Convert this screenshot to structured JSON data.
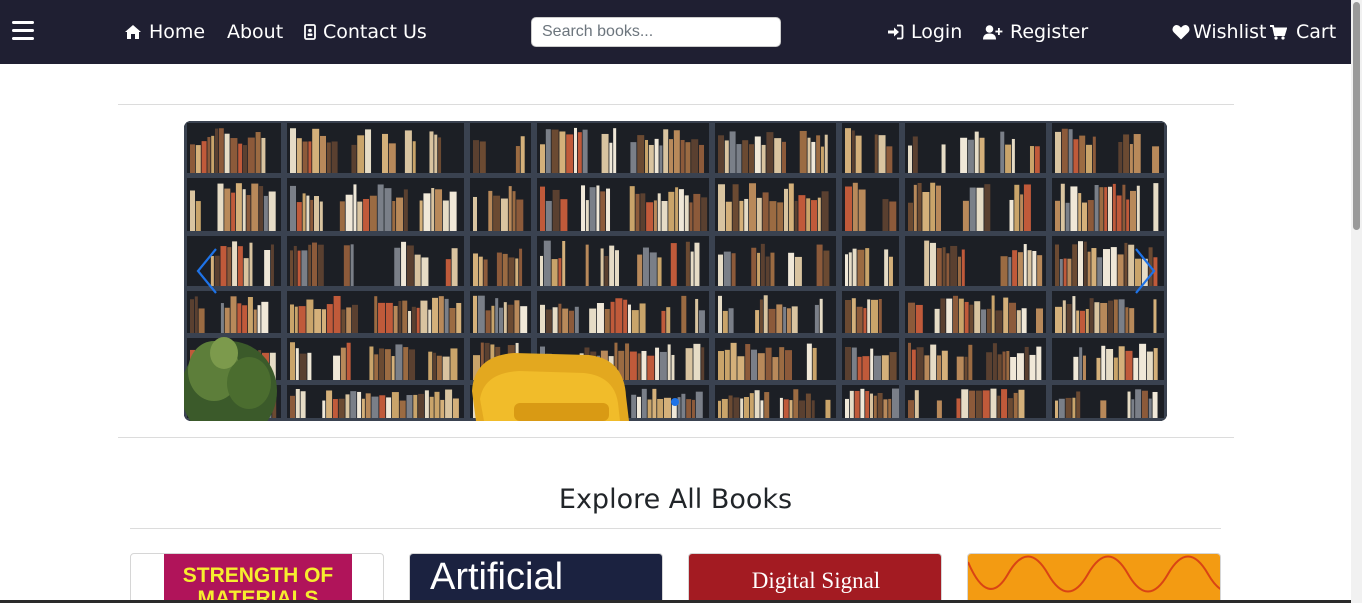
{
  "nav": {
    "home": "Home",
    "about": "About",
    "contact": "Contact Us",
    "login": "Login",
    "register": "Register",
    "wishlist": "Wishlist",
    "cart": "Cart",
    "search_placeholder": "Search books..."
  },
  "carousel": {
    "slide_count": 1,
    "active_index": 0
  },
  "section": {
    "title": "Explore All Books"
  },
  "books": [
    {
      "cover_text_1": "STRENGTH OF",
      "cover_text_2": "MATERIALS"
    },
    {
      "cover_text_1": "Artificial"
    },
    {
      "cover_text_1": "Digital Signal"
    },
    {
      "cover_text_1": ""
    }
  ],
  "colors": {
    "navbar": "#1f1f32",
    "accent": "#1e73e8"
  }
}
